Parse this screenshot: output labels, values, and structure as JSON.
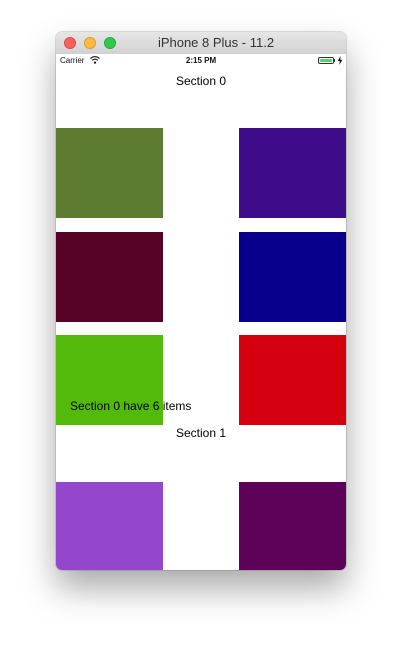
{
  "window": {
    "title": "iPhone 8 Plus - 11.2"
  },
  "status_bar": {
    "carrier": "Carrier",
    "time": "2:15 PM",
    "battery_level": 1.0,
    "charging": true
  },
  "sections": [
    {
      "header": "Section 0",
      "footer": "Section 0 have 6 items",
      "items": [
        {
          "color": "#5d7c31"
        },
        {
          "color": "#3e0b8a"
        },
        {
          "color": "#570328"
        },
        {
          "color": "#08008c"
        },
        {
          "color": "#53b90b"
        },
        {
          "color": "#d4000f"
        }
      ]
    },
    {
      "header": "Section 1",
      "items": [
        {
          "color": "#9347cd"
        },
        {
          "color": "#5d0159"
        },
        {
          "color": "#b8403b"
        },
        {
          "color": "#28518f"
        }
      ]
    }
  ]
}
